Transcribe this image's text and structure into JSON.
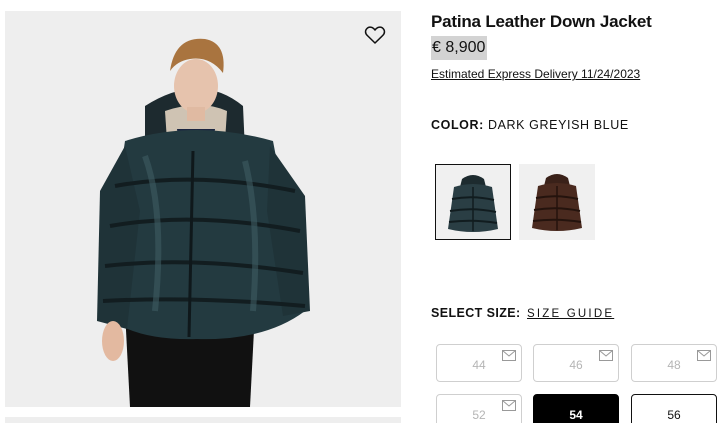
{
  "product": {
    "title": "Patina Leather Down Jacket",
    "price": "€ 8,900",
    "delivery": "Estimated Express Delivery 11/24/2023"
  },
  "color": {
    "label": "COLOR:",
    "value": "DARK GREYISH BLUE",
    "swatches": [
      {
        "name": "dark greyish blue",
        "tone": "#2a3e44",
        "selected": true
      },
      {
        "name": "brown",
        "tone": "#4a2a1f",
        "selected": false
      }
    ]
  },
  "size": {
    "label": "SELECT SIZE:",
    "guide": "SIZE GUIDE",
    "options": [
      {
        "label": "44",
        "state": "disabled"
      },
      {
        "label": "46",
        "state": "disabled"
      },
      {
        "label": "48",
        "state": "disabled"
      },
      {
        "label": "52",
        "state": "disabled"
      },
      {
        "label": "54",
        "state": "selected"
      },
      {
        "label": "56",
        "state": "available"
      }
    ]
  },
  "icons": {
    "wishlist": "heart-icon",
    "notify": "mail-icon"
  },
  "colors": {
    "price_highlight": "#d3d3d3",
    "selected_size_bg": "#000000",
    "image_bg": "#eeeeee"
  }
}
